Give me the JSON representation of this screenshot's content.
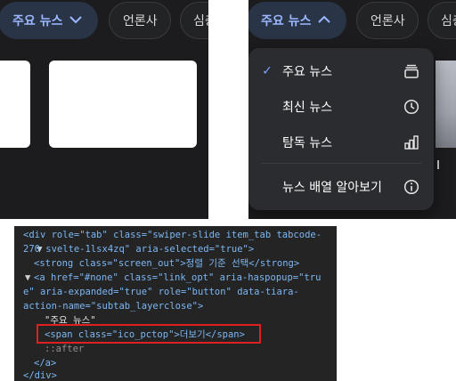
{
  "panel_closed": {
    "active_tab": {
      "label": "주요 뉴스",
      "chevron": "chevron-down-icon"
    },
    "tabs": [
      "언론사",
      "심층"
    ]
  },
  "panel_open": {
    "active_tab": {
      "label": "주요 뉴스",
      "chevron": "chevron-up-icon"
    },
    "tabs": [
      "언론사",
      "심층"
    ],
    "menu": {
      "items": [
        {
          "label": "주요 뉴스",
          "selected": true,
          "icon": "stack-icon"
        },
        {
          "label": "최신 뉴스",
          "selected": false,
          "icon": "clock-icon"
        },
        {
          "label": "탐독 뉴스",
          "selected": false,
          "icon": "bar-chart-icon"
        },
        {
          "label": "뉴스 배열 알아보기",
          "selected": false,
          "icon": "info-icon"
        }
      ],
      "check_glyph": "✓"
    }
  },
  "devtools": {
    "lines": {
      "l1a": "<div role=\"tab\" class=\"swiper-slide item_tab tabcode-",
      "l1b": "270 svelte-1lsx4zq\" aria-selected=\"true\">",
      "l2": "<strong class=\"screen_out\">정렬 기준 선택</strong>",
      "l3a": "<a href=\"#none\" class=\"link_opt\" aria-haspopup=\"tru",
      "l3b": "e\" aria-expanded=\"true\" role=\"button\" data-tiara-",
      "l3c": "action-name=\"subtab_layerclose\">",
      "l4": "\"주요 뉴스\"",
      "l5": "<span class=\"ico_pctop\">더보기</span>",
      "l6": "::after",
      "l7": "</a>",
      "l8": "</div>"
    }
  },
  "colors": {
    "accent": "#9ab7ff",
    "check": "#7aa2ff",
    "highlight": "#e02020"
  }
}
